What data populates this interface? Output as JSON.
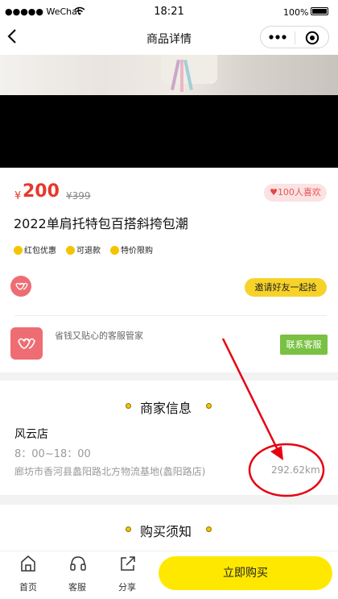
{
  "status_bar": {
    "carrier": "●●●●● WeChat",
    "time": "18:21",
    "battery": "100%"
  },
  "nav": {
    "title": "商品详情"
  },
  "product": {
    "currency": "¥",
    "price": "200",
    "old_price": "¥399",
    "likes": "100人喜欢",
    "title": "2022单肩托特包百搭斜挎包潮",
    "tags": [
      "红包优惠",
      "可退款",
      "特价限购"
    ],
    "invite_label": "邀请好友一起抢"
  },
  "service": {
    "text": "省钱又贴心的客服管家",
    "contact_label": "联系客服"
  },
  "merchant": {
    "section_title": "商家信息",
    "shop_name": "风云店",
    "hours": "8：00~18：00",
    "address": "廊坊市香河县蠡阳路北方物流基地(蠡阳路店)",
    "distance": "292.62km"
  },
  "notice": {
    "section_title": "购买须知"
  },
  "tabbar": {
    "home": "首页",
    "service": "客服",
    "share": "分享",
    "buy": "立即购买"
  },
  "colors": {
    "price": "#e6382b",
    "accent": "#ffe800",
    "contact": "#7ac143",
    "annotation": "#e60012"
  },
  "icons": [
    "back-arrow-icon",
    "more-dots-icon",
    "target-close-icon",
    "heart-icon",
    "check-icon",
    "home-icon",
    "headset-icon",
    "share-icon"
  ]
}
